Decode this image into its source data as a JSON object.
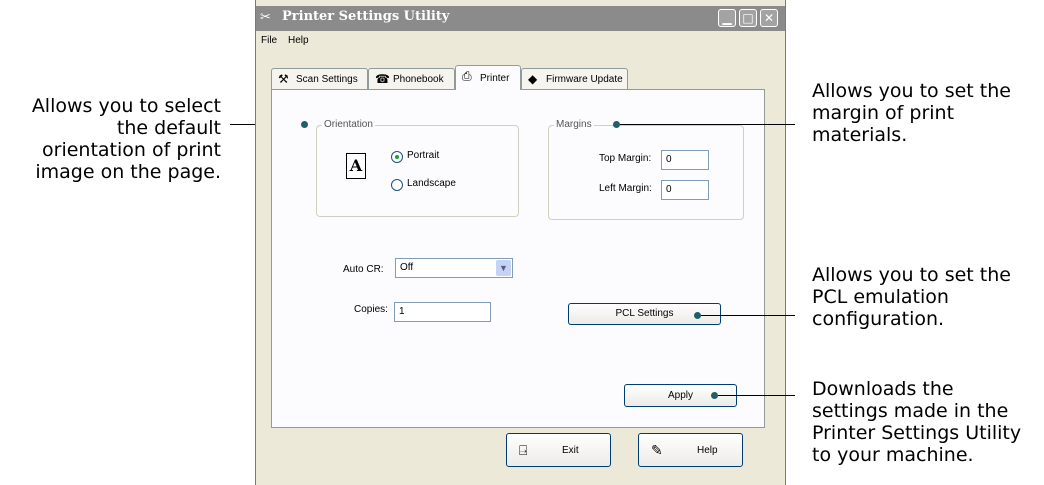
{
  "window": {
    "title": "Printer Settings Utility",
    "menu": [
      "File",
      "Help"
    ]
  },
  "tabs": [
    {
      "label": "Scan Settings",
      "icon": "scan-settings-icon"
    },
    {
      "label": "Phonebook",
      "icon": "phonebook-icon"
    },
    {
      "label": "Printer",
      "icon": "printer-icon",
      "active": true
    },
    {
      "label": "Firmware Update",
      "icon": "firmware-icon"
    }
  ],
  "orientation": {
    "group_title": "Orientation",
    "page_icon_letter": "A",
    "options": [
      {
        "label": "Portrait",
        "selected": true
      },
      {
        "label": "Landscape",
        "selected": false
      }
    ]
  },
  "margins": {
    "group_title": "Margins",
    "top_label": "Top Margin:",
    "top_value": "0",
    "left_label": "Left Margin:",
    "left_value": "0"
  },
  "auto_cr": {
    "label": "Auto CR:",
    "value": "Off"
  },
  "copies": {
    "label": "Copies:",
    "value": "1"
  },
  "buttons": {
    "pcl": "PCL Settings",
    "apply": "Apply",
    "exit": "Exit",
    "help": "Help"
  },
  "callouts": {
    "orientation": "Allows you to select\nthe default\norientation of print\nimage on the page.",
    "margins": "Allows you to set the\nmargin of print\nmaterials.",
    "pcl": "Allows you to set the\nPCL emulation\nconfiguration.",
    "apply": "Downloads the\nsettings made in the\nPrinter Settings Utility\nto your machine."
  },
  "colors": {
    "titlebar": "#8b8b8b",
    "dialog_bg": "#ece9d8",
    "callout_dot": "#1f5f6a"
  }
}
